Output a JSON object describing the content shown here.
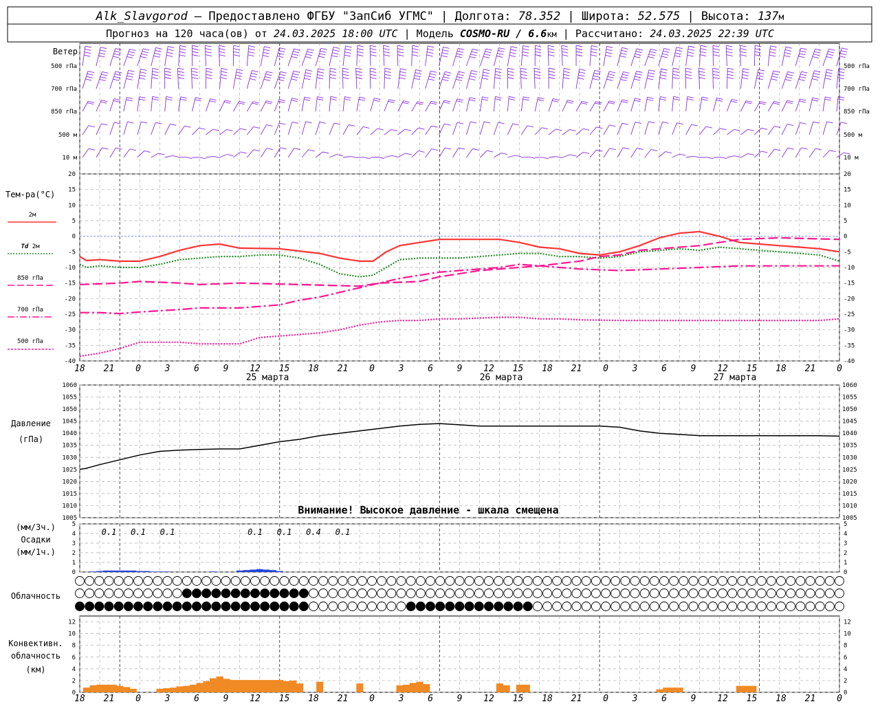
{
  "header": {
    "station": "Alk_Slavgorod",
    "provider": " — Предоставлено ФГБУ \"ЗапСиб УГМС\" | ",
    "lon_label": "Долгота:",
    "lon": "78.352",
    "lat_label": " | Широта:",
    "lat": "52.575",
    "alt_label": " | Высота:",
    "alt": "137",
    "alt_unit": "м",
    "forecast_label": "Прогноз на 120 часа(ов) от",
    "forecast_from": "24.03.2025 18:00 UTC",
    "model_label": " | Модель",
    "model": "COSMO-RU / 6.6",
    "model_unit": "км",
    "calc_label": " | Рассчитано:",
    "calc_time": "24.03.2025 22:39 UTC"
  },
  "time_axis": {
    "hour_ticks": [
      "18",
      "21",
      "0",
      "3",
      "6",
      "9",
      "12",
      "15",
      "18",
      "21",
      "0",
      "3",
      "6",
      "9",
      "12",
      "15",
      "18",
      "21",
      "0",
      "3",
      "6",
      "9",
      "12",
      "15",
      "18",
      "21",
      "0"
    ],
    "day_labels": [
      "25 марта",
      "26 марта",
      "27 марта"
    ]
  },
  "wind": {
    "title": "Ветер",
    "levels": [
      "500 гПа",
      "700 гПа",
      "850 гПа",
      "500 м",
      "10  м"
    ],
    "color": "#8a2be2"
  },
  "temperature": {
    "title": "Тем-ра(°C)",
    "legend": [
      {
        "name": "2м",
        "color": "#ff3333",
        "style": "solid"
      },
      {
        "name_italic": "Td",
        "name": "2м",
        "color": "#228b22",
        "style": "dotted"
      },
      {
        "name": "850 гПа",
        "color": "#ff1493",
        "style": "dashed"
      },
      {
        "name": "700 гПа",
        "color": "#ff1493",
        "style": "dashdot"
      },
      {
        "name": "500 гПа",
        "color": "#ff1493",
        "style": "dotted"
      }
    ],
    "ticks": [
      "20",
      "15",
      "10",
      "5",
      "0",
      "-5",
      "-10",
      "-15",
      "-20",
      "-25",
      "-30",
      "-35",
      "-40"
    ]
  },
  "pressure": {
    "title": "Давление",
    "unit": "(гПа)",
    "ticks": [
      "1060",
      "1055",
      "1050",
      "1045",
      "1040",
      "1035",
      "1030",
      "1025",
      "1020",
      "1015",
      "1010",
      "1005"
    ],
    "warning": "Внимание! Высокое давление - шкала смещена"
  },
  "precip": {
    "unit3": "(мм/3ч.)",
    "title": "Осадки",
    "unit1": "(мм/1ч.)",
    "ticks": [
      "5",
      "4",
      "3",
      "2",
      "1",
      "0"
    ],
    "labels_3h": [
      {
        "hour": 3,
        "text": "0.1"
      },
      {
        "hour": 6,
        "text": "0.1"
      },
      {
        "hour": 9,
        "text": "0.1"
      },
      {
        "hour": 18,
        "text": "0.1"
      },
      {
        "hour": 21,
        "text": "0.1"
      },
      {
        "hour": 24,
        "text": "0.4"
      },
      {
        "hour": 27,
        "text": "0.1"
      }
    ]
  },
  "cloud": {
    "title": "Облачность"
  },
  "convective": {
    "title1": "Конвективн.",
    "title2": "облачность",
    "title3": "(км)",
    "ticks": [
      "12",
      "10",
      "8",
      "6",
      "4",
      "2",
      "0"
    ],
    "color": "#f08a24"
  },
  "chart_data": [
    {
      "type": "line",
      "title": "Тем-ра(°C)",
      "x_unit": "hours from 24.03.2025 18:00 UTC",
      "ylim": [
        -40,
        20
      ],
      "series": [
        {
          "name": "2м",
          "points": [
            [
              0,
              -6.5
            ],
            [
              1,
              -7.8
            ],
            [
              3,
              -7.5
            ],
            [
              6,
              -8
            ],
            [
              9,
              -8
            ],
            [
              12,
              -6.5
            ],
            [
              15,
              -4.5
            ],
            [
              18,
              -3
            ],
            [
              21,
              -2.5
            ],
            [
              24,
              -3.8
            ],
            [
              30,
              -4
            ],
            [
              36,
              -5.5
            ],
            [
              39,
              -7
            ],
            [
              42,
              -8
            ],
            [
              44,
              -8
            ],
            [
              46,
              -5
            ],
            [
              48,
              -3
            ],
            [
              51,
              -2
            ],
            [
              54,
              -1
            ],
            [
              57,
              -1
            ],
            [
              63,
              -1
            ],
            [
              66,
              -2
            ],
            [
              69,
              -3.5
            ],
            [
              72,
              -4
            ],
            [
              75,
              -5.5
            ],
            [
              78,
              -6
            ],
            [
              81,
              -5
            ],
            [
              84,
              -3
            ],
            [
              87,
              -0.5
            ],
            [
              90,
              1
            ],
            [
              93,
              1.5
            ],
            [
              96,
              0
            ],
            [
              99,
              -2
            ],
            [
              102,
              -2.5
            ],
            [
              105,
              -3
            ],
            [
              108,
              -3.5
            ],
            [
              111,
              -4
            ],
            [
              114,
              -5
            ]
          ]
        },
        {
          "name": "Td 2м",
          "points": [
            [
              0,
              -9
            ],
            [
              1,
              -10
            ],
            [
              3,
              -9.5
            ],
            [
              6,
              -10
            ],
            [
              9,
              -10
            ],
            [
              12,
              -9
            ],
            [
              15,
              -7.5
            ],
            [
              18,
              -7
            ],
            [
              21,
              -6.5
            ],
            [
              24,
              -6.5
            ],
            [
              27,
              -6
            ],
            [
              30,
              -6
            ],
            [
              33,
              -7
            ],
            [
              36,
              -9
            ],
            [
              39,
              -12
            ],
            [
              42,
              -13
            ],
            [
              44,
              -12.5
            ],
            [
              46,
              -10
            ],
            [
              48,
              -7.5
            ],
            [
              51,
              -7
            ],
            [
              54,
              -7
            ],
            [
              57,
              -7
            ],
            [
              63,
              -6
            ],
            [
              66,
              -5.5
            ],
            [
              69,
              -5.5
            ],
            [
              72,
              -6.5
            ],
            [
              75,
              -6.5
            ],
            [
              78,
              -7
            ],
            [
              81,
              -6.5
            ],
            [
              84,
              -5
            ],
            [
              87,
              -4.5
            ],
            [
              90,
              -4
            ],
            [
              93,
              -4.5
            ],
            [
              96,
              -3.5
            ],
            [
              99,
              -4
            ],
            [
              102,
              -4.5
            ],
            [
              105,
              -5
            ],
            [
              108,
              -5.5
            ],
            [
              111,
              -6
            ],
            [
              114,
              -8
            ]
          ]
        },
        {
          "name": "850 гПа",
          "points": [
            [
              0,
              -15.5
            ],
            [
              6,
              -15
            ],
            [
              9,
              -14.5
            ],
            [
              15,
              -15
            ],
            [
              18,
              -15.5
            ],
            [
              24,
              -15
            ],
            [
              33,
              -15.5
            ],
            [
              42,
              -16
            ],
            [
              45,
              -15
            ],
            [
              51,
              -14.5
            ],
            [
              54,
              -13
            ],
            [
              57,
              -12
            ],
            [
              60,
              -11
            ],
            [
              66,
              -10
            ],
            [
              69,
              -9.5
            ],
            [
              75,
              -8
            ],
            [
              78,
              -6.5
            ],
            [
              81,
              -6
            ],
            [
              84,
              -4.5
            ],
            [
              87,
              -4
            ],
            [
              93,
              -3
            ],
            [
              96,
              -2
            ],
            [
              99,
              -1
            ],
            [
              105,
              -0.5
            ],
            [
              114,
              -1
            ]
          ]
        },
        {
          "name": "700 гПа",
          "points": [
            [
              0,
              -24.5
            ],
            [
              3,
              -24.5
            ],
            [
              6,
              -24.8
            ],
            [
              9,
              -24.3
            ],
            [
              15,
              -23.5
            ],
            [
              18,
              -23
            ],
            [
              24,
              -23
            ],
            [
              27,
              -22.5
            ],
            [
              30,
              -22
            ],
            [
              33,
              -20.5
            ],
            [
              36,
              -19.5
            ],
            [
              39,
              -18
            ],
            [
              42,
              -16.5
            ],
            [
              45,
              -15
            ],
            [
              48,
              -13.5
            ],
            [
              51,
              -12.5
            ],
            [
              54,
              -11.5
            ],
            [
              57,
              -11
            ],
            [
              63,
              -10
            ],
            [
              66,
              -9
            ],
            [
              69,
              -9.5
            ],
            [
              72,
              -10
            ],
            [
              75,
              -10.5
            ],
            [
              81,
              -11
            ],
            [
              87,
              -10.5
            ],
            [
              93,
              -10
            ],
            [
              99,
              -9.5
            ],
            [
              105,
              -9.5
            ],
            [
              114,
              -9.5
            ]
          ]
        },
        {
          "name": "500 гПа",
          "points": [
            [
              0,
              -38.5
            ],
            [
              3,
              -37.5
            ],
            [
              6,
              -36
            ],
            [
              9,
              -34
            ],
            [
              12,
              -34
            ],
            [
              15,
              -34
            ],
            [
              18,
              -34.5
            ],
            [
              21,
              -34.5
            ],
            [
              24,
              -34.5
            ],
            [
              27,
              -32.5
            ],
            [
              30,
              -32
            ],
            [
              33,
              -31.5
            ],
            [
              36,
              -31
            ],
            [
              39,
              -30
            ],
            [
              42,
              -28.5
            ],
            [
              45,
              -27.5
            ],
            [
              48,
              -27
            ],
            [
              51,
              -27
            ],
            [
              54,
              -26.5
            ],
            [
              57,
              -26.5
            ],
            [
              63,
              -26
            ],
            [
              66,
              -26
            ],
            [
              69,
              -26.5
            ],
            [
              72,
              -26.5
            ],
            [
              75,
              -26.8
            ],
            [
              81,
              -27
            ],
            [
              87,
              -27
            ],
            [
              93,
              -27
            ],
            [
              99,
              -27
            ],
            [
              105,
              -27
            ],
            [
              111,
              -27
            ],
            [
              114,
              -26.5
            ]
          ]
        }
      ]
    },
    {
      "type": "line",
      "title": "Давление",
      "ylabel": "(гПа)",
      "x_unit": "hours from 24.03.2025 18:00 UTC",
      "ylim": [
        1005,
        1060
      ],
      "series": [
        {
          "name": "Давление",
          "points": [
            [
              0,
              1025
            ],
            [
              1,
              1025.5
            ],
            [
              3,
              1027
            ],
            [
              6,
              1029
            ],
            [
              9,
              1031
            ],
            [
              12,
              1032.5
            ],
            [
              15,
              1033
            ],
            [
              18,
              1033.3
            ],
            [
              21,
              1033.5
            ],
            [
              24,
              1033.5
            ],
            [
              27,
              1035
            ],
            [
              30,
              1036.5
            ],
            [
              33,
              1037.5
            ],
            [
              36,
              1039
            ],
            [
              39,
              1040
            ],
            [
              42,
              1041
            ],
            [
              45,
              1042
            ],
            [
              48,
              1043
            ],
            [
              51,
              1043.7
            ],
            [
              54,
              1044
            ],
            [
              57,
              1043.5
            ],
            [
              60,
              1043
            ],
            [
              63,
              1043
            ],
            [
              66,
              1043
            ],
            [
              69,
              1043
            ],
            [
              72,
              1043
            ],
            [
              75,
              1043
            ],
            [
              78,
              1043
            ],
            [
              81,
              1042.5
            ],
            [
              84,
              1041
            ],
            [
              87,
              1040
            ],
            [
              90,
              1039.5
            ],
            [
              93,
              1039
            ],
            [
              96,
              1039
            ],
            [
              99,
              1039
            ],
            [
              105,
              1039
            ],
            [
              111,
              1039
            ],
            [
              114,
              1038.8
            ]
          ]
        }
      ]
    },
    {
      "type": "bar",
      "title": "Осадки",
      "ylabel": "(мм/1ч.)",
      "x_unit": "hours from 24.03.2025 18:00 UTC",
      "ylim": [
        0,
        5
      ],
      "x": [
        2,
        3,
        4,
        5,
        6,
        7,
        8,
        9,
        10,
        11,
        12,
        13,
        20,
        24,
        25,
        26,
        27,
        28,
        29,
        30
      ],
      "values": [
        0.05,
        0.1,
        0.15,
        0.15,
        0.15,
        0.15,
        0.15,
        0.1,
        0.1,
        0.05,
        0.05,
        0.05,
        0.05,
        0.15,
        0.2,
        0.25,
        0.3,
        0.25,
        0.2,
        0.1
      ]
    },
    {
      "type": "bar",
      "title": "Конвективн. облачность",
      "ylabel": "(км)",
      "x_unit": "hours from 24.03.2025 18:00 UTC",
      "ylim": [
        0,
        13
      ],
      "x": [
        1,
        2,
        3,
        4,
        5,
        6,
        7,
        8,
        12,
        13,
        14,
        15,
        16,
        17,
        18,
        19,
        20,
        21,
        22,
        23,
        24,
        25,
        26,
        27,
        28,
        29,
        30,
        31,
        32,
        33,
        36,
        42,
        48,
        49,
        50,
        51,
        52,
        63,
        64,
        66,
        67,
        87,
        88,
        89,
        90,
        99,
        100,
        101
      ],
      "values": [
        0.8,
        1.2,
        1.3,
        1.3,
        1.3,
        1.1,
        0.9,
        0.6,
        0.6,
        0.7,
        0.8,
        1.0,
        1.1,
        1.3,
        1.6,
        1.9,
        2.4,
        2.7,
        2.3,
        2.1,
        2.1,
        2.1,
        2.1,
        2.1,
        2.1,
        2.1,
        2.1,
        1.9,
        2.0,
        1.5,
        1.8,
        1.5,
        1.2,
        1.3,
        1.6,
        1.8,
        1.4,
        1.5,
        1.2,
        1.3,
        1.3,
        0.5,
        0.8,
        0.8,
        0.8,
        1.1,
        1.1,
        1.1
      ]
    }
  ]
}
